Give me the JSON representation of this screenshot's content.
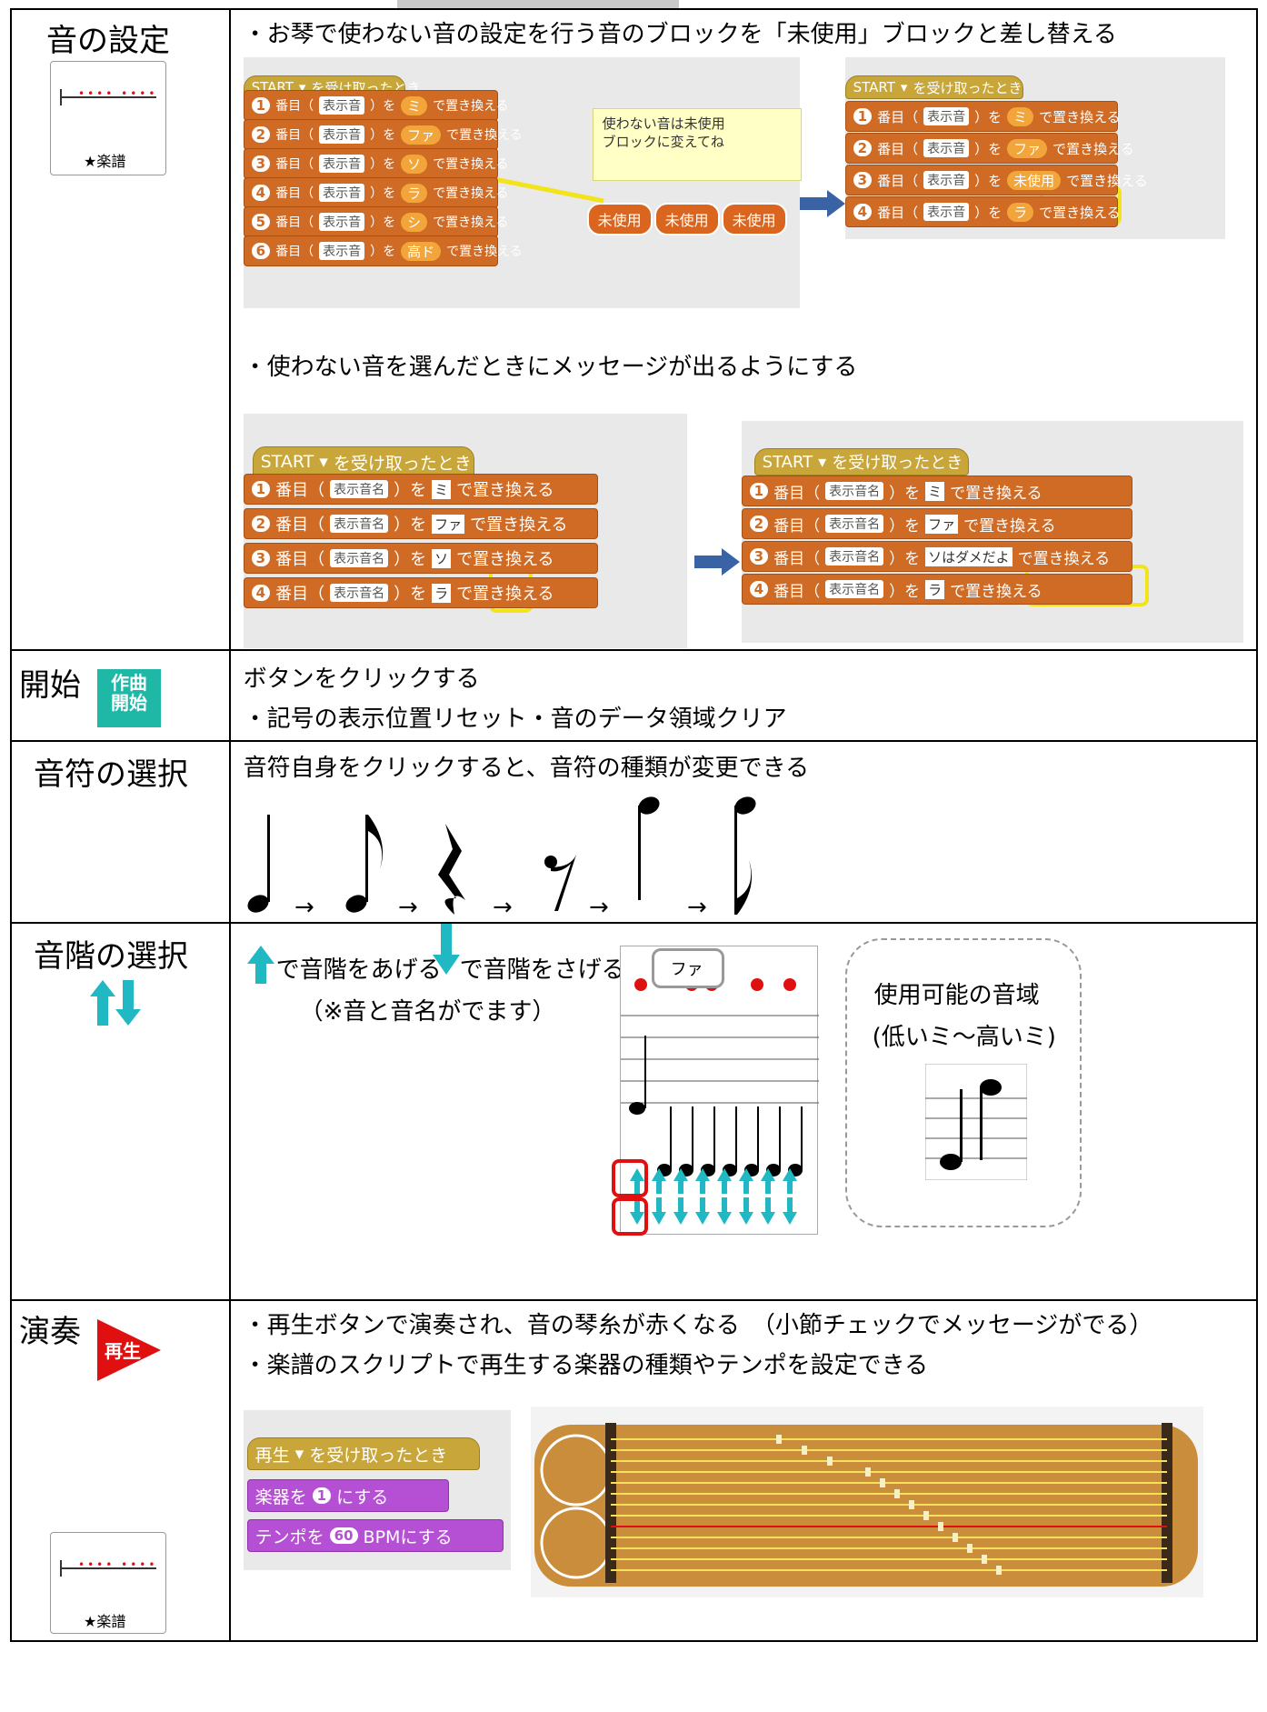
{
  "rows": [
    {
      "title": "音の設定",
      "thumb_label": "★楽譜",
      "line1": "・お琴で使わない音の設定を行う音のブロックを「未使用」ブロックと差し替える",
      "line2": "・使わない音を選んだときにメッセージが出るようにする"
    },
    {
      "title": "開始",
      "button_text": "作曲\n開始",
      "line1": "ボタンをクリックする",
      "line2": "・記号の表示位置リセット・音のデータ領域クリア"
    },
    {
      "title": "音符の選択",
      "line1": "音符自身をクリックすると、音符の種類が変更できる"
    },
    {
      "title": "音階の選択",
      "line1_a": "で音階をあげる",
      "line1_b": "で音階をさげる",
      "line2": "（※音と音名がでます）",
      "bubble": "ファ",
      "range_title": "使用可能の音域",
      "range_sub": "(低いミ～高いミ)"
    },
    {
      "title": "演奏",
      "button_text": "再生",
      "thumb_label": "★楽譜",
      "line1": "・再生ボタンで演奏され、音の琴糸が赤くなる　（小節チェックでメッセージがでる）",
      "line2": "・楽譜のスクリプトで再生する楽器の種類やテンポを設定できる"
    }
  ],
  "blocks_a": {
    "hat": "START",
    "hat_tail": "を受け取ったとき",
    "row_mid": "番目（",
    "field": "表示音",
    "wo": "）を",
    "tail": "で置き換える",
    "notes": [
      "ミ",
      "ファ",
      "ソ",
      "ラ",
      "シ",
      "高ド"
    ],
    "nums": [
      "1",
      "2",
      "3",
      "4",
      "5",
      "6"
    ],
    "comment": "使わない音は未使用\nブロックに変えてね",
    "unused": "未使用",
    "right_notes": [
      "ミ",
      "ファ",
      "未使用",
      "ラ"
    ]
  },
  "blocks_b": {
    "hat": "START",
    "hat_tail": "を受け取ったとき",
    "row_mid": "番目（",
    "field": "表示音名",
    "wo": "）を",
    "tail": "で置き換える",
    "notes": [
      "ミ",
      "ファ",
      "ソ",
      "ラ"
    ],
    "right_notes": [
      "ミ",
      "ファ",
      "ソはダメだよ",
      "ラ"
    ]
  },
  "blocks_play": {
    "hat": "再生",
    "hat_tail": "を受け取ったとき",
    "instr_a": "楽器を",
    "instr_val": "1",
    "instr_b": "にする",
    "tempo_a": "テンポを",
    "tempo_val": "60",
    "tempo_b": "BPMにする"
  },
  "colors": {
    "scratch_orange": "#cf6b25",
    "scratch_purple": "#b54fd3",
    "highlight_yellow": "#f2e31a",
    "arrow_teal": "#1fb8c3",
    "red": "#e01010"
  }
}
